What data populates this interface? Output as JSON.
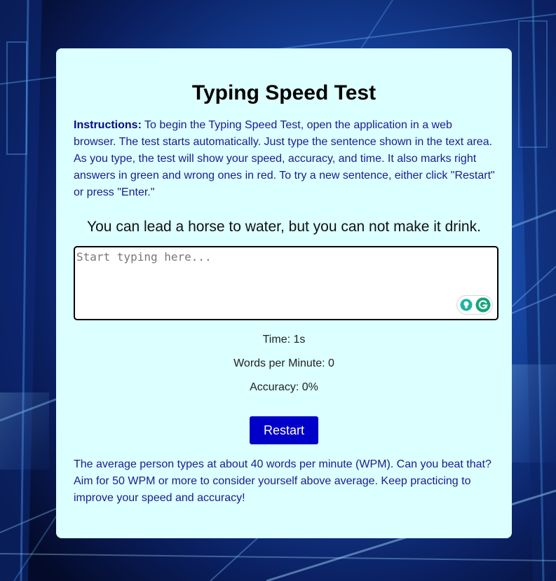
{
  "app": {
    "title": "Typing Speed Test"
  },
  "instructions": {
    "label": "Instructions:",
    "text": " To begin the Typing Speed Test, open the application in a web browser. The test starts automatically. Just type the sentence shown in the text area. As you type, the test will show your speed, accuracy, and time. It also marks right answers in green and wrong ones in red. To try a new sentence, either click \"Restart\" or press \"Enter.\""
  },
  "sentence": "You can lead a horse to water, but you can not make it drink.",
  "input": {
    "value": "",
    "placeholder": "Start typing here..."
  },
  "extension": {
    "icons": [
      "lightbulb-icon",
      "grammarly-icon"
    ]
  },
  "stats": {
    "time_label": "Time: 1s",
    "wpm_label": "Words per Minute: 0",
    "accuracy_label": "Accuracy: 0%"
  },
  "controls": {
    "restart_label": "Restart"
  },
  "footer": {
    "text": "The average person types at about 40 words per minute (WPM). Can you beat that? Aim for 50 WPM or more to consider yourself above average. Keep practicing to improve your speed and accuracy!"
  },
  "colors": {
    "card_background": "#dcffff",
    "accent_button": "#0000c8",
    "body_text": "#1c1c8c",
    "grammarly_green": "#15a57a",
    "bulb_teal": "#1bb4a6"
  }
}
